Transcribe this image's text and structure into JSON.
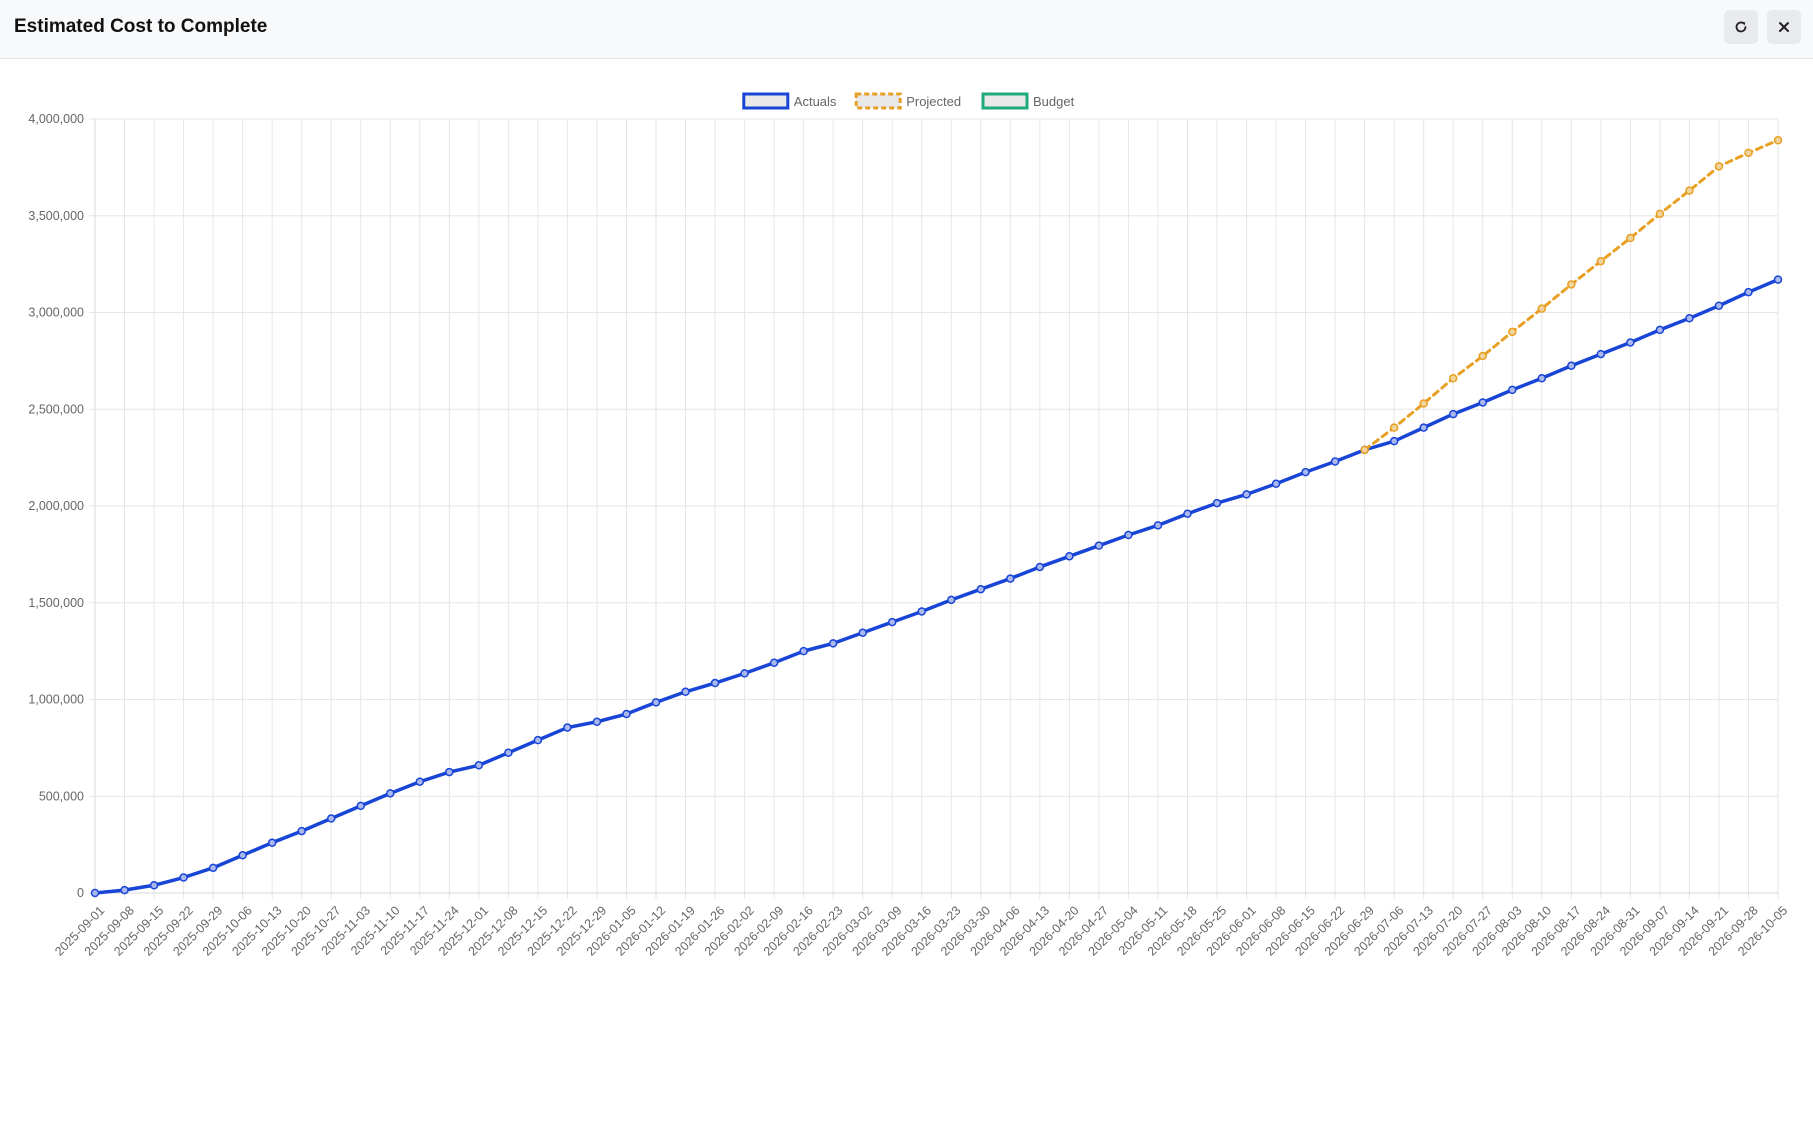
{
  "header": {
    "title": "Estimated Cost to Complete",
    "refresh_icon": "refresh-icon",
    "close_icon": "close-icon"
  },
  "chart_data": {
    "type": "line",
    "title": "",
    "xlabel": "",
    "ylabel": "",
    "ylim": [
      0,
      4000000
    ],
    "yticks": [
      0,
      500000,
      1000000,
      1500000,
      2000000,
      2500000,
      3000000,
      3500000,
      4000000
    ],
    "grid": true,
    "legend": "top-center",
    "x": [
      "2025-09-01",
      "2025-09-08",
      "2025-09-15",
      "2025-09-22",
      "2025-09-29",
      "2025-10-06",
      "2025-10-13",
      "2025-10-20",
      "2025-10-27",
      "2025-11-03",
      "2025-11-10",
      "2025-11-17",
      "2025-11-24",
      "2025-12-01",
      "2025-12-08",
      "2025-12-15",
      "2025-12-22",
      "2025-12-29",
      "2026-01-05",
      "2026-01-12",
      "2026-01-19",
      "2026-01-26",
      "2026-02-02",
      "2026-02-09",
      "2026-02-16",
      "2026-02-23",
      "2026-03-02",
      "2026-03-09",
      "2026-03-16",
      "2026-03-23",
      "2026-03-30",
      "2026-04-06",
      "2026-04-13",
      "2026-04-20",
      "2026-04-27",
      "2026-05-04",
      "2026-05-11",
      "2026-05-18",
      "2026-05-25",
      "2026-06-01",
      "2026-06-08",
      "2026-06-15",
      "2026-06-22",
      "2026-06-29",
      "2026-07-06",
      "2026-07-13",
      "2026-07-20",
      "2026-07-27",
      "2026-08-03",
      "2026-08-10",
      "2026-08-17",
      "2026-08-24",
      "2026-08-31",
      "2026-09-07",
      "2026-09-14",
      "2026-09-21",
      "2026-09-28",
      "2026-10-05"
    ],
    "series": [
      {
        "name": "Actuals",
        "color": "#1845d6",
        "style": "solid",
        "values": [
          0,
          15000,
          40000,
          80000,
          130000,
          195000,
          260000,
          320000,
          385000,
          450000,
          515000,
          575000,
          625000,
          660000,
          725000,
          790000,
          855000,
          885000,
          925000,
          985000,
          1040000,
          1085000,
          1135000,
          1190000,
          1250000,
          1290000,
          1345000,
          1400000,
          1455000,
          1515000,
          1570000,
          1625000,
          1685000,
          1740000,
          1795000,
          1850000,
          1900000,
          1960000,
          2015000,
          2060000,
          2115000,
          2175000,
          2230000,
          2290000,
          2335000,
          2405000,
          2475000,
          2535000,
          2600000,
          2660000,
          2725000,
          2785000,
          2845000,
          2910000,
          2970000,
          3035000,
          3105000,
          3170000
        ]
      },
      {
        "name": "Projected",
        "color": "#e8a024",
        "style": "dashed",
        "start_index": 43,
        "values": [
          2290000,
          2405000,
          2530000,
          2660000,
          2775000,
          2900000,
          3020000,
          3145000,
          3265000,
          3385000,
          3510000,
          3630000,
          3755000,
          3825000,
          3890000
        ]
      },
      {
        "name": "Budget",
        "color": "#1faa7e",
        "style": "solid",
        "values": []
      }
    ]
  }
}
